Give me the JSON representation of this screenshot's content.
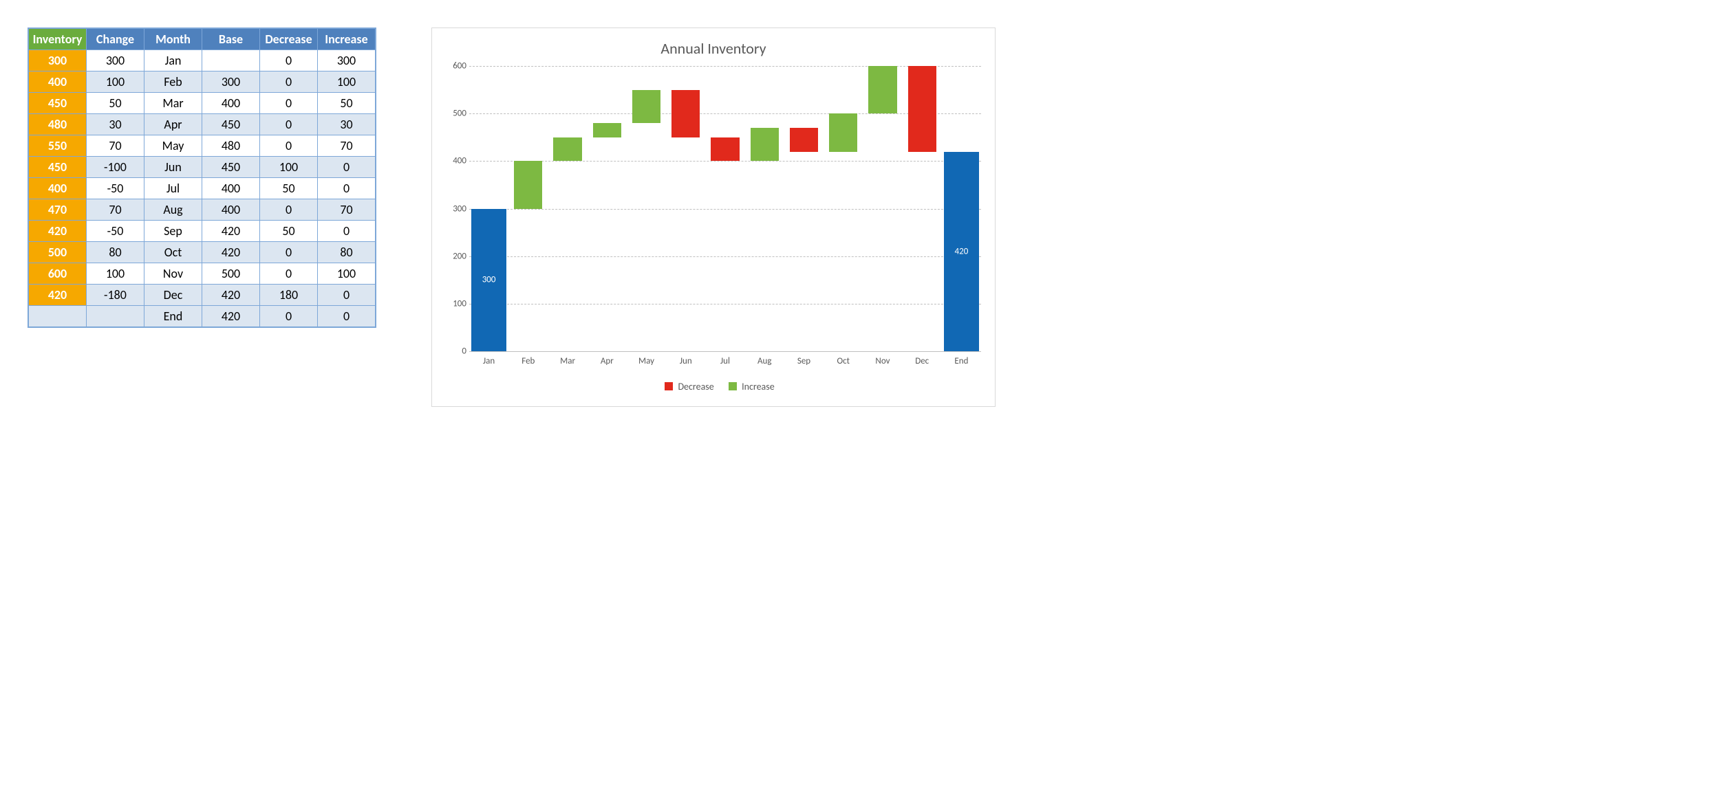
{
  "table": {
    "headers": [
      "Inventory",
      "Change",
      "Month",
      "Base",
      "Decrease",
      "Increase"
    ],
    "rows": [
      {
        "inventory": "300",
        "change": "300",
        "month": "Jan",
        "base": "",
        "decrease": "0",
        "increase": "300",
        "banded": false
      },
      {
        "inventory": "400",
        "change": "100",
        "month": "Feb",
        "base": "300",
        "decrease": "0",
        "increase": "100",
        "banded": true
      },
      {
        "inventory": "450",
        "change": "50",
        "month": "Mar",
        "base": "400",
        "decrease": "0",
        "increase": "50",
        "banded": false
      },
      {
        "inventory": "480",
        "change": "30",
        "month": "Apr",
        "base": "450",
        "decrease": "0",
        "increase": "30",
        "banded": true
      },
      {
        "inventory": "550",
        "change": "70",
        "month": "May",
        "base": "480",
        "decrease": "0",
        "increase": "70",
        "banded": false
      },
      {
        "inventory": "450",
        "change": "-100",
        "month": "Jun",
        "base": "450",
        "decrease": "100",
        "increase": "0",
        "banded": true
      },
      {
        "inventory": "400",
        "change": "-50",
        "month": "Jul",
        "base": "400",
        "decrease": "50",
        "increase": "0",
        "banded": false
      },
      {
        "inventory": "470",
        "change": "70",
        "month": "Aug",
        "base": "400",
        "decrease": "0",
        "increase": "70",
        "banded": true
      },
      {
        "inventory": "420",
        "change": "-50",
        "month": "Sep",
        "base": "420",
        "decrease": "50",
        "increase": "0",
        "banded": false
      },
      {
        "inventory": "500",
        "change": "80",
        "month": "Oct",
        "base": "420",
        "decrease": "0",
        "increase": "80",
        "banded": true
      },
      {
        "inventory": "600",
        "change": "100",
        "month": "Nov",
        "base": "500",
        "decrease": "0",
        "increase": "100",
        "banded": false
      },
      {
        "inventory": "420",
        "change": "-180",
        "month": "Dec",
        "base": "420",
        "decrease": "180",
        "increase": "0",
        "banded": true
      }
    ],
    "end_row": {
      "inventory": "",
      "change": "",
      "month": "End",
      "base": "420",
      "decrease": "0",
      "increase": "0"
    }
  },
  "chart_data": {
    "type": "bar",
    "title": "Annual Inventory",
    "xlabel": "",
    "ylabel": "",
    "ylim": [
      0,
      600
    ],
    "y_ticks": [
      0,
      100,
      200,
      300,
      400,
      500,
      600
    ],
    "colors": {
      "start_end": "#1168b4",
      "increase": "#7db942",
      "decrease": "#e1291c"
    },
    "legend": [
      {
        "name": "Decrease",
        "color": "#e1291c"
      },
      {
        "name": "Increase",
        "color": "#7db942"
      }
    ],
    "categories": [
      "Jan",
      "Feb",
      "Mar",
      "Apr",
      "May",
      "Jun",
      "Jul",
      "Aug",
      "Sep",
      "Oct",
      "Nov",
      "Dec",
      "End"
    ],
    "bars": [
      {
        "label": "Jan",
        "kind": "start",
        "bottom": 0,
        "top": 300,
        "value_label": "300"
      },
      {
        "label": "Feb",
        "kind": "increase",
        "bottom": 300,
        "top": 400
      },
      {
        "label": "Mar",
        "kind": "increase",
        "bottom": 400,
        "top": 450
      },
      {
        "label": "Apr",
        "kind": "increase",
        "bottom": 450,
        "top": 480
      },
      {
        "label": "May",
        "kind": "increase",
        "bottom": 480,
        "top": 550
      },
      {
        "label": "Jun",
        "kind": "decrease",
        "bottom": 450,
        "top": 550
      },
      {
        "label": "Jul",
        "kind": "decrease",
        "bottom": 400,
        "top": 450
      },
      {
        "label": "Aug",
        "kind": "increase",
        "bottom": 400,
        "top": 470
      },
      {
        "label": "Sep",
        "kind": "decrease",
        "bottom": 420,
        "top": 470
      },
      {
        "label": "Oct",
        "kind": "increase",
        "bottom": 420,
        "top": 500
      },
      {
        "label": "Nov",
        "kind": "increase",
        "bottom": 500,
        "top": 600
      },
      {
        "label": "Dec",
        "kind": "decrease",
        "bottom": 420,
        "top": 600
      },
      {
        "label": "End",
        "kind": "end",
        "bottom": 0,
        "top": 420,
        "value_label": "420"
      }
    ]
  }
}
